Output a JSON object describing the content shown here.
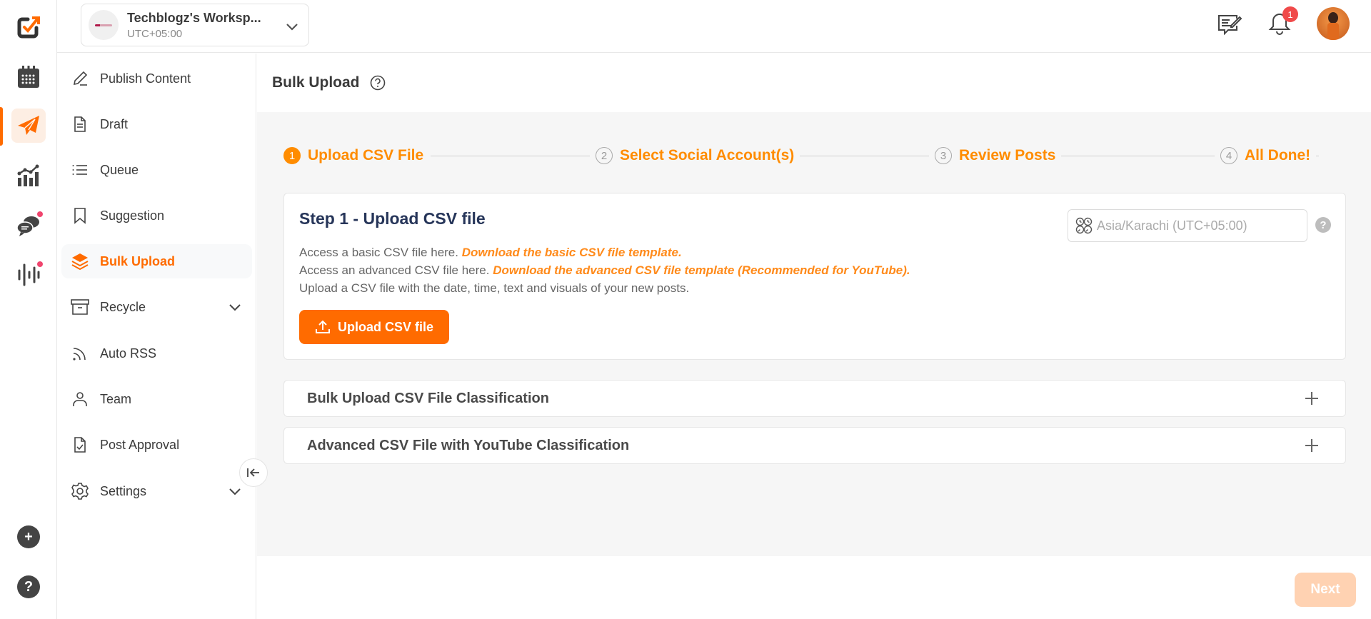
{
  "rail": {
    "items": [
      {
        "name": "dashboard-logo"
      },
      {
        "name": "planner"
      },
      {
        "name": "publisher",
        "active": true
      },
      {
        "name": "analytics"
      },
      {
        "name": "inbox",
        "notification_dot": true
      },
      {
        "name": "listening",
        "notification_dot": true
      }
    ],
    "bottom": [
      {
        "name": "add",
        "glyph": "+"
      },
      {
        "name": "help",
        "glyph": "?"
      }
    ]
  },
  "topbar": {
    "workspace_name": "Techblogz's Worksp...",
    "workspace_timezone": "UTC+05:00",
    "notification_count": "1"
  },
  "sidebar": {
    "items": [
      {
        "label": "Publish Content"
      },
      {
        "label": "Draft"
      },
      {
        "label": "Queue"
      },
      {
        "label": "Suggestion"
      },
      {
        "label": "Bulk Upload",
        "active": true
      },
      {
        "label": "Recycle",
        "expandable": true
      },
      {
        "label": "Auto RSS"
      },
      {
        "label": "Team"
      },
      {
        "label": "Post Approval"
      },
      {
        "label": "Settings",
        "expandable": true
      }
    ]
  },
  "main": {
    "title": "Bulk Upload",
    "steps": [
      {
        "num": "1",
        "label": "Upload CSV File",
        "active": true
      },
      {
        "num": "2",
        "label": "Select Social Account(s)"
      },
      {
        "num": "3",
        "label": "Review Posts"
      },
      {
        "num": "4",
        "label": "All Done!"
      }
    ],
    "card": {
      "title": "Step 1 - Upload CSV file",
      "line1_text": "Access a basic CSV file here. ",
      "line1_link": "Download the basic CSV file template.",
      "line2_text": "Access an advanced CSV file here. ",
      "line2_link": "Download the advanced CSV file template (Recommended for YouTube).",
      "line3_text": "Upload a CSV file with the date, time, text and visuals of your new posts.",
      "upload_button": "Upload CSV file",
      "timezone_value": "Asia/Karachi (UTC+05:00)",
      "timezone_help": "?"
    },
    "accordions": [
      {
        "title": "Bulk Upload CSV File Classification"
      },
      {
        "title": "Advanced CSV File with YouTube Classification"
      }
    ],
    "next_button": "Next"
  },
  "colors": {
    "accent": "#ff6b00",
    "step_accent": "#ff8c00",
    "title_navy": "#263559",
    "badge_red": "#f04a4a"
  }
}
